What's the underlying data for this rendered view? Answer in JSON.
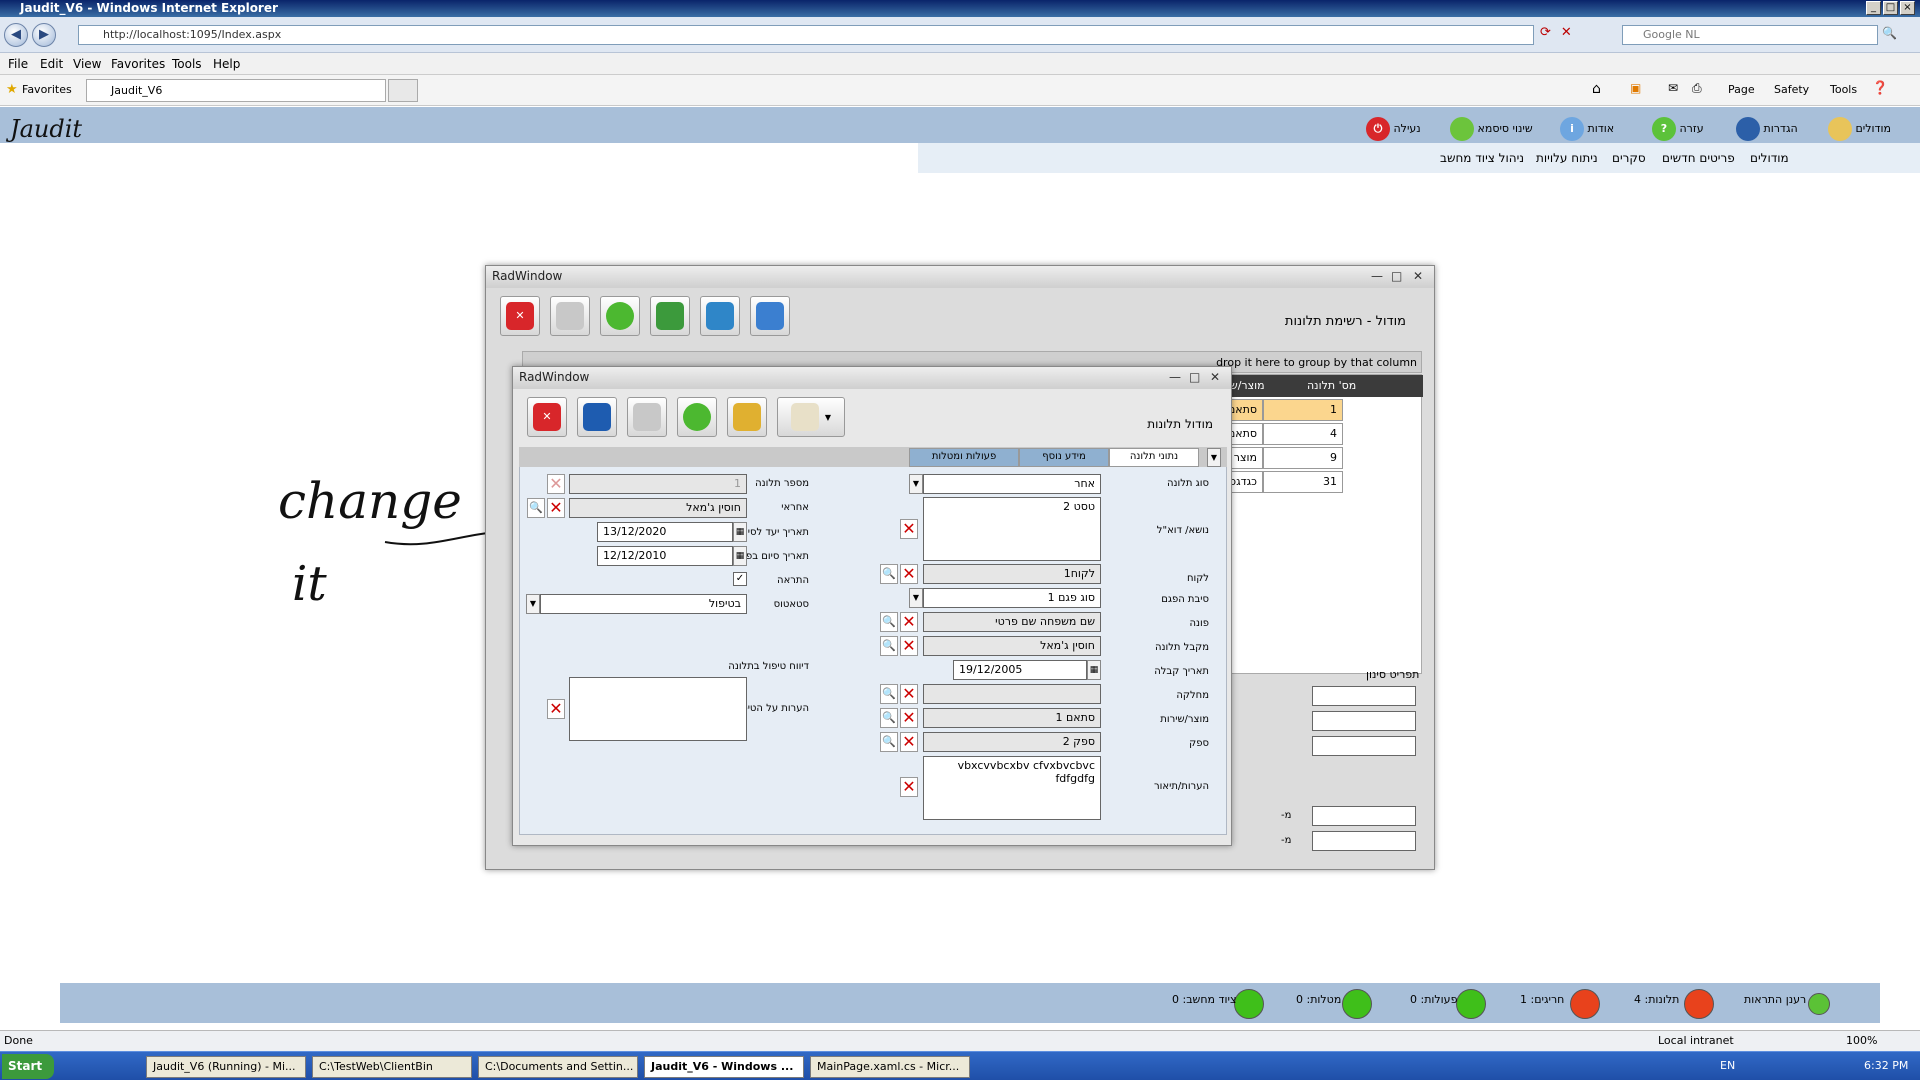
{
  "browser": {
    "title": "Jaudit_V6 - Windows Internet Explorer",
    "url": "http://localhost:1095/Index.aspx",
    "search_placeholder": "Google NL",
    "menu": [
      "File",
      "Edit",
      "View",
      "Favorites",
      "Tools",
      "Help"
    ],
    "favorites_label": "Favorites",
    "tab_title": "Jaudit_V6",
    "toolbar": {
      "page": "Page",
      "safety": "Safety",
      "tools": "Tools"
    },
    "status_done": "Done",
    "zone": "Local intranet",
    "zoom": "100%"
  },
  "app": {
    "logo": "Jaudit",
    "topmenu": {
      "modules": "מודולים",
      "settings": "הגדרות",
      "help": "עזרה",
      "about": "אודות",
      "change_password": "שינוי סיסמא",
      "lock": "נעילה"
    },
    "submenu": {
      "modules": "מודולים",
      "new_items": "פריטים חדשים",
      "surveys": "סקרים",
      "cost_analysis": "ניתוח עלויות",
      "computer_equipment": "ניהול ציוד מחשב"
    }
  },
  "outer_window": {
    "title": "RadWindow",
    "header": "מודול - רשימת תלונות",
    "group_hint": "drop it here to group by that column",
    "columns": {
      "complaint_no": "מס' תלונה",
      "product": "מוצר/שירות"
    },
    "rows": [
      {
        "no": "1",
        "product": "סתאם 1"
      },
      {
        "no": "4",
        "product": "סתאם 1"
      },
      {
        "no": "9",
        "product": "מוצר חדש 33"
      },
      {
        "no": "31",
        "product": "כגדגכ"
      }
    ],
    "filter_title": "תפריט סינון",
    "from_label": "מ-"
  },
  "inner_window": {
    "title": "RadWindow",
    "header": "מודול  תלונות",
    "tabs": {
      "data": "נתוני תלונה",
      "extra": "מידע נוסף",
      "actions": "פעולות ומטלות"
    },
    "labels": {
      "complaint_type": "סוג תלונה",
      "subject": "נושא/ דוא\"ל",
      "customer": "לקוח",
      "fault_reason": "סיבת הפגם",
      "contact": "פונה",
      "receiver": "מקבל תלונה",
      "received_date": "תאריך קבלה",
      "department": "מחלקה",
      "product": "מוצר/שירות",
      "supplier": "ספק",
      "notes": "הערות/תיאור",
      "complaint_no": "מספר תלונה",
      "responsible": "אחראי",
      "target_date": "תאריך יעד לסיום",
      "actual_end": "תאריך סיום בפועל",
      "alert": "התראה",
      "status": "סטאטוס",
      "handling_report": "דיווח טיפול בתלונה",
      "handling_notes": "הערות על הטיפול"
    },
    "values": {
      "complaint_type": "אחר",
      "subject": "טסט 2",
      "customer": "לקוח1",
      "fault_reason": "סוג פגם 1",
      "contact": "שם משפחה שם פרטי",
      "receiver": "חוסין ג'מאל",
      "received_date": "19/12/2005",
      "department": "",
      "product": "סתאם 1",
      "supplier": "ספק 2",
      "notes": "vbxcvvbcxbv cfvxbvcbvc fdfgdfg",
      "complaint_no": "1",
      "responsible": "חוסין ג'מאל",
      "target_date": "13/12/2020",
      "actual_end": "12/12/2010",
      "status": "בטיפול"
    }
  },
  "annotation": {
    "line1": "change",
    "line2": "it"
  },
  "alerts": {
    "refresh": "רענן התראות",
    "complaints": "תלונות: 4",
    "exceptions": "חריגים: 1",
    "actions": "פעולות: 0",
    "tasks": "מטלות: 0",
    "equipment": "ציוד מחשב: 0",
    "colors": {
      "red": "#e8421c",
      "green": "#3fbf1a"
    }
  },
  "taskbar": {
    "start": "Start",
    "items": [
      "Jaudit_V6 (Running) - Mi...",
      "C:\\TestWeb\\ClientBin",
      "C:\\Documents and Settin...",
      "Jaudit_V6 - Windows ...",
      "MainPage.xaml.cs - Micr..."
    ],
    "lang": "EN",
    "clock": "6:32 PM"
  }
}
